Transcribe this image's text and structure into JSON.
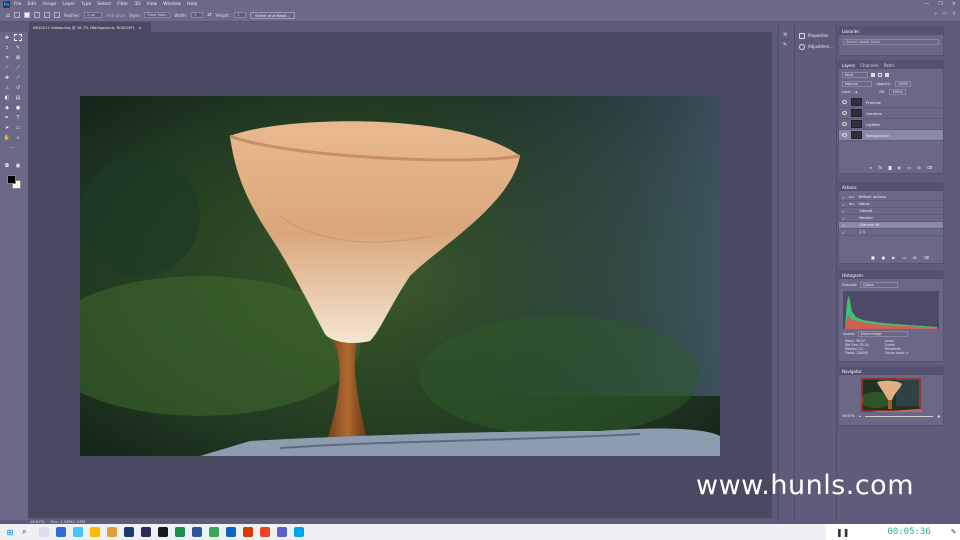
{
  "app": {
    "logo": "Ps",
    "name": "Adobe Photoshop"
  },
  "menu": [
    "File",
    "Edit",
    "Image",
    "Layer",
    "Type",
    "Select",
    "Filter",
    "3D",
    "View",
    "Window",
    "Help"
  ],
  "window_controls": [
    "—",
    "❐",
    "✕"
  ],
  "options_bar": {
    "feather_label": "Feather:",
    "feather_value": "0 px",
    "antialias_label": "Anti-alias",
    "style_label": "Style:",
    "style_value": "Fixed Ratio",
    "width_label": "Width:",
    "width_value": "1",
    "height_label": "Height:",
    "height_value": "1",
    "select_mask_button": "Select and Mask..."
  },
  "document": {
    "tab_title": "IMG0211 fallow.dng @ 16.7% (Background, RGB/16*) ",
    "close": "×"
  },
  "statusbar": {
    "zoom": "16.67%",
    "doc_info": "Doc: 1.56M/1.56M"
  },
  "props_panel": {
    "items": [
      {
        "icon": "properties-icon",
        "label": "Properties"
      },
      {
        "icon": "adjustments-icon",
        "label": "Adjustmen..."
      }
    ]
  },
  "libraries": {
    "title": "Libraries",
    "search_placeholder": "Search Adobe Stock"
  },
  "layers": {
    "tabs": [
      "Layers",
      "Channels",
      "Paths"
    ],
    "kind_label": "Kind",
    "blend_mode": "Normal",
    "opacity_label": "Opacity:",
    "opacity_value": "100%",
    "lock_label": "Lock:",
    "fill_label": "Fill:",
    "fill_value": "100%",
    "rows": [
      {
        "name": "Preview"
      },
      {
        "name": "Gardens"
      },
      {
        "name": "Lighten"
      },
      {
        "name": "Background"
      }
    ]
  },
  "actions": {
    "title": "Actions",
    "rows": [
      {
        "label": "Default Actions",
        "indent": 0
      },
      {
        "label": "Vibrac",
        "indent": 0
      },
      {
        "label": "Vibrant",
        "indent": 1
      },
      {
        "label": "Neutral",
        "indent": 1
      },
      {
        "label": "Glamour M",
        "indent": 1
      },
      {
        "label": "2 4",
        "indent": 1
      }
    ]
  },
  "histogram": {
    "title": "Histogram",
    "channel_label": "Channel:",
    "channel_value": "Colors",
    "source_label": "Source:",
    "source_value": "Entire Image",
    "stats_left": [
      "Mean: 36.57",
      "Std Dev: 35.16",
      "Median: 23",
      "Pixels: 120000"
    ],
    "stats_right": [
      "Level:",
      "Count:",
      "Percentile:",
      "Cache Level: 4"
    ]
  },
  "navigator": {
    "title": "Navigator",
    "zoom": "16.67%"
  },
  "watermark": "www.hunls.com",
  "recorder": {
    "time": "00:05:36"
  },
  "colors": {
    "accent": "#31a8ff",
    "panel": "#6a6886",
    "canvas_bg": "#4a4962",
    "rec_green": "#26b58c"
  }
}
